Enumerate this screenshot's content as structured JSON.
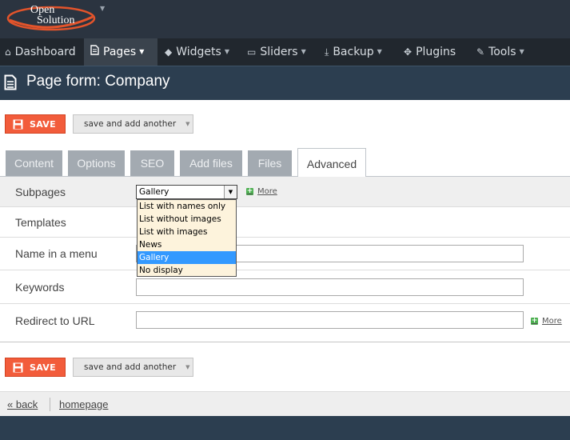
{
  "logo": {
    "line1": "Open",
    "line2": "Solution"
  },
  "nav": {
    "items": [
      {
        "label": "Dashboard",
        "icon": "home-icon",
        "has_caret": false
      },
      {
        "label": "Pages",
        "icon": "document-icon",
        "has_caret": true,
        "active": true
      },
      {
        "label": "Widgets",
        "icon": "cube-icon",
        "has_caret": true
      },
      {
        "label": "Sliders",
        "icon": "image-icon",
        "has_caret": true
      },
      {
        "label": "Backup",
        "icon": "download-icon",
        "has_caret": true
      },
      {
        "label": "Plugins",
        "icon": "puzzle-icon",
        "has_caret": false
      },
      {
        "label": "Tools",
        "icon": "wrench-icon",
        "has_caret": true
      }
    ]
  },
  "page": {
    "title": "Page form: Company"
  },
  "toolbar": {
    "save_label": "SAVE",
    "save_another_label": "save and add another"
  },
  "tabs": [
    "Content",
    "Options",
    "SEO",
    "Add files",
    "Files",
    "Advanced"
  ],
  "active_tab": "Advanced",
  "form": {
    "subpages": {
      "label": "Subpages",
      "selected": "Gallery",
      "options": [
        "List with names only",
        "List without images",
        "List with images",
        "News",
        "Gallery",
        "No display"
      ],
      "more_label": "More"
    },
    "templates": {
      "label": "Templates"
    },
    "name_in_menu": {
      "label": "Name in a menu",
      "value": ""
    },
    "keywords": {
      "label": "Keywords",
      "value": ""
    },
    "redirect": {
      "label": "Redirect to URL",
      "value": "",
      "more_label": "More"
    }
  },
  "footer": {
    "back_label": "« back",
    "homepage_label": "homepage"
  },
  "colors": {
    "topbar": "#2b3440",
    "navbar": "#21272e",
    "header": "#2c3e50",
    "save": "#f25c3b",
    "tab_inactive": "#a3aab1",
    "dropdown_bg": "#fdf3dc",
    "dropdown_selected": "#3399ff",
    "logo_swoosh": "#e3542b"
  }
}
